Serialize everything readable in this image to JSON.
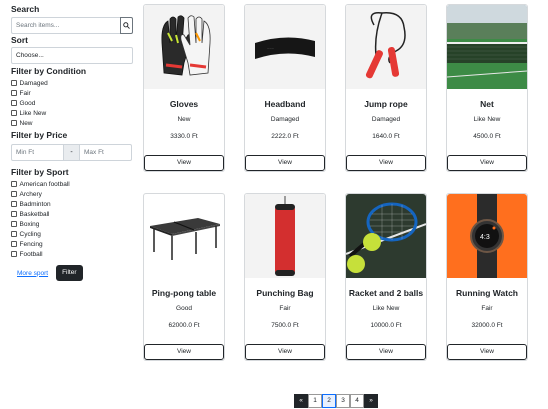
{
  "sidebar": {
    "search_title": "Search",
    "search_placeholder": "Search items...",
    "search_icon": "search-icon",
    "sort_title": "Sort",
    "sort_value": "Choose...",
    "condition_title": "Filter by Condition",
    "conditions": [
      "Damaged",
      "Fair",
      "Good",
      "Like New",
      "New"
    ],
    "price_title": "Filter by Price",
    "min_placeholder": "Min Ft",
    "separator": "-",
    "max_placeholder": "Max Ft",
    "sport_title": "Filter by Sport",
    "sports": [
      "American football",
      "Archery",
      "Badminton",
      "Basketball",
      "Boxing",
      "Cycling",
      "Fencing",
      "Football"
    ],
    "more_sport": "More sport",
    "filter_button": "Filter"
  },
  "products": [
    {
      "name": "Gloves",
      "condition": "New",
      "price": "3330.0 Ft",
      "view": "View",
      "image": "goalkeeper-gloves"
    },
    {
      "name": "Headband",
      "condition": "Damaged",
      "price": "2222.0 Ft",
      "view": "View",
      "image": "headband"
    },
    {
      "name": "Jump rope",
      "condition": "Damaged",
      "price": "1640.0 Ft",
      "view": "View",
      "image": "jump-rope"
    },
    {
      "name": "Net",
      "condition": "Like New",
      "price": "4500.0 Ft",
      "view": "View",
      "image": "tennis-net"
    },
    {
      "name": "Ping-pong table",
      "condition": "Good",
      "price": "62000.0 Ft",
      "view": "View",
      "image": "ping-pong-table"
    },
    {
      "name": "Punching Bag",
      "condition": "Fair",
      "price": "7500.0 Ft",
      "view": "View",
      "image": "punching-bag"
    },
    {
      "name": "Racket and 2 balls",
      "condition": "Like New",
      "price": "10000.0 Ft",
      "view": "View",
      "image": "racket-balls"
    },
    {
      "name": "Running Watch",
      "condition": "Fair",
      "price": "32000.0 Ft",
      "view": "View",
      "image": "running-watch"
    }
  ],
  "pagination": {
    "prev": "«",
    "pages": [
      "1",
      "2",
      "3",
      "4"
    ],
    "active": "2",
    "next": "»"
  }
}
